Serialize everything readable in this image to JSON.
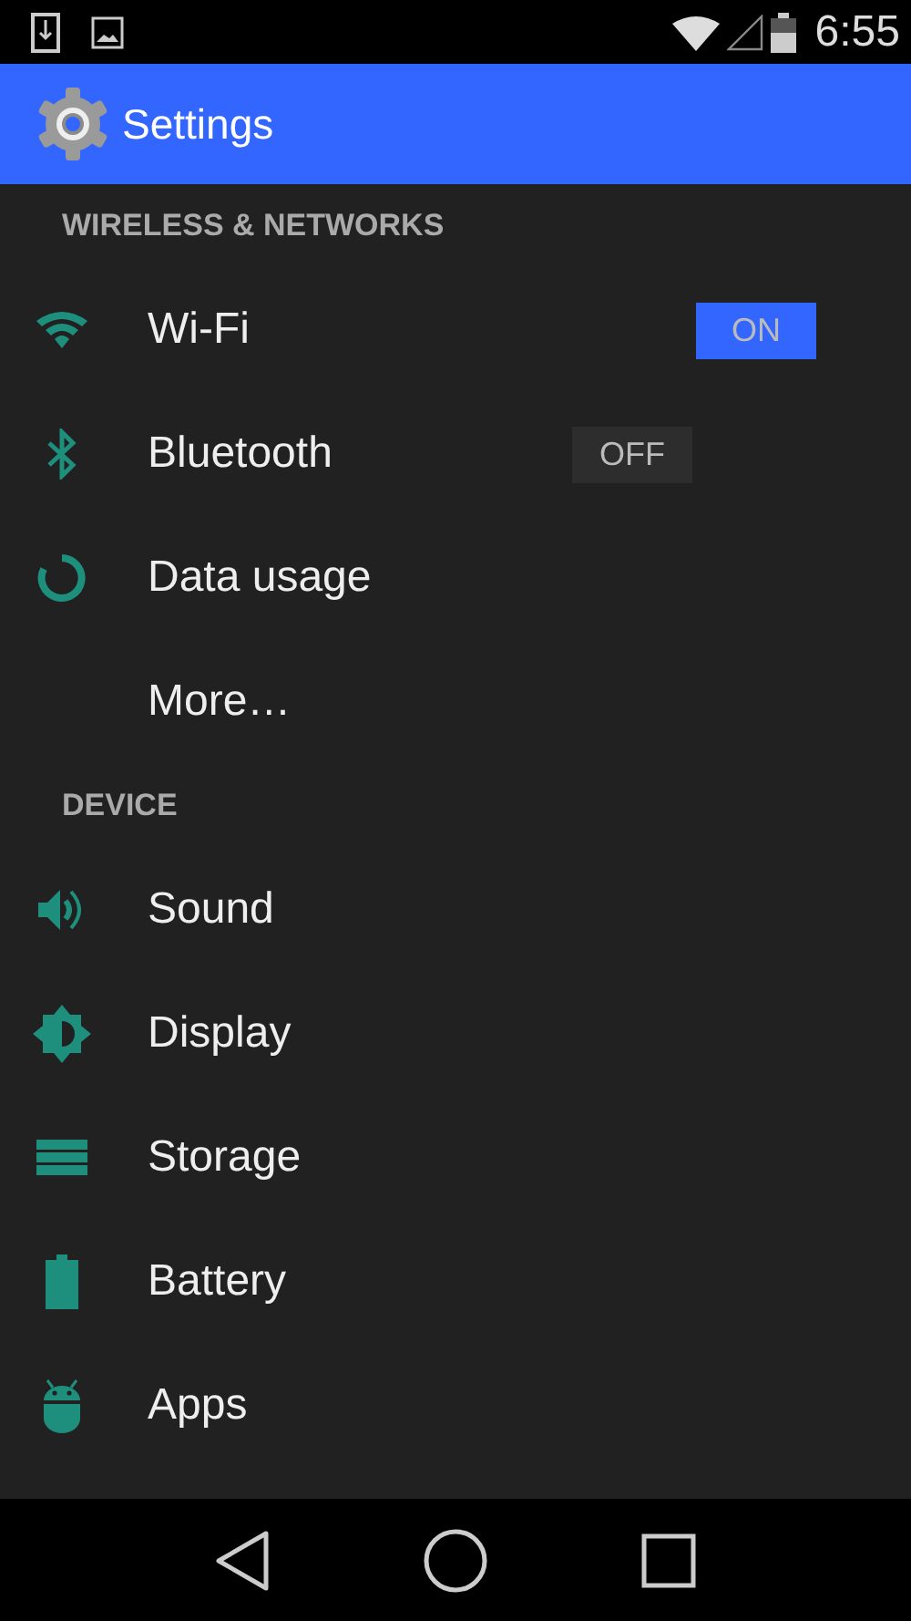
{
  "status_bar": {
    "time": "6:55"
  },
  "action_bar": {
    "title": "Settings"
  },
  "sections": [
    {
      "title": "WIRELESS & NETWORKS",
      "items": [
        {
          "kind": "toggle",
          "label": "Wi-Fi",
          "switch": {
            "on": true,
            "text": "ON"
          }
        },
        {
          "kind": "toggle",
          "label": "Bluetooth",
          "switch": {
            "on": false,
            "text": "OFF"
          }
        },
        {
          "kind": "plain",
          "label": "Data usage"
        },
        {
          "kind": "plain",
          "label": "More…"
        }
      ]
    },
    {
      "title": "DEVICE",
      "items": [
        {
          "kind": "plain",
          "label": "Sound"
        },
        {
          "kind": "plain",
          "label": "Display"
        },
        {
          "kind": "plain",
          "label": "Storage"
        },
        {
          "kind": "plain",
          "label": "Battery"
        },
        {
          "kind": "plain",
          "label": "Apps"
        }
      ]
    }
  ]
}
